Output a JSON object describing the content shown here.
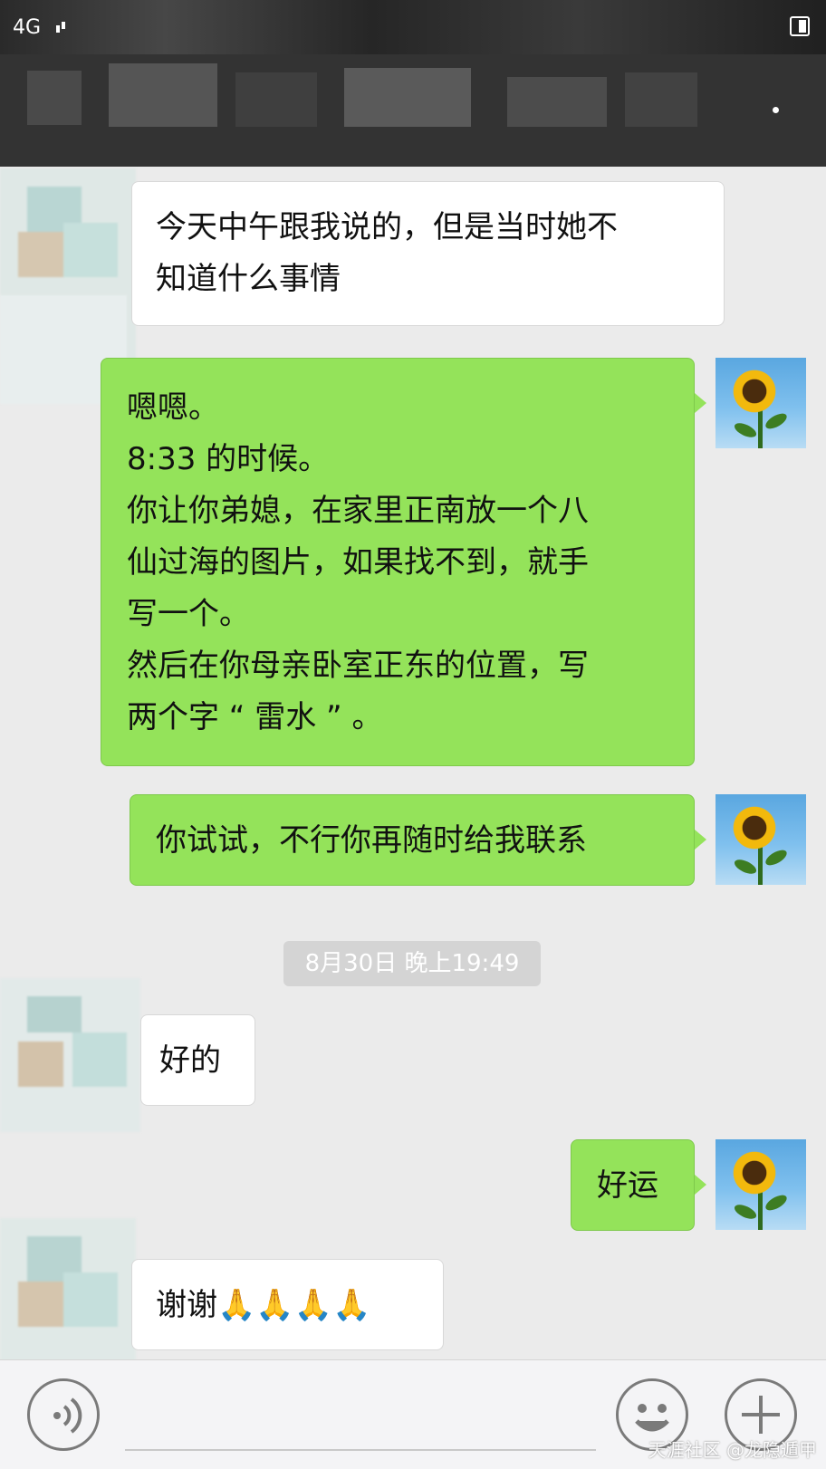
{
  "status_bar": {
    "network": "4G"
  },
  "messages": [
    {
      "side": "left",
      "lines": [
        "今天中午跟我说的，但是当时她不",
        "知道什么事情"
      ]
    },
    {
      "side": "right",
      "lines": [
        "嗯嗯。",
        "8:33 的时候。",
        "你让你弟媳，在家里正南放一个八",
        "仙过海的图片，如果找不到，就手",
        "写一个。",
        "然后在你母亲卧室正东的位置，写",
        "两个字 “ 雷水 ” 。"
      ]
    },
    {
      "side": "right",
      "lines": [
        "你试试，不行你再随时给我联系"
      ]
    },
    {
      "side": "left",
      "lines": [
        "好的"
      ]
    },
    {
      "side": "right",
      "lines": [
        "好运"
      ]
    },
    {
      "side": "left",
      "lines": [
        "谢谢🙏🙏🙏🙏"
      ]
    }
  ],
  "timestamp": "8月30日 晚上19:49",
  "icons": {
    "voice": "voice-icon",
    "emoji": "emoji-icon",
    "plus": "plus-icon",
    "avatar_self": "sunflower-avatar"
  },
  "watermark": "天涯社区 @龙隐遁甲",
  "colors": {
    "sent_bubble": "#94e35a",
    "received_bubble": "#ffffff",
    "chat_background": "#ebebeb"
  }
}
